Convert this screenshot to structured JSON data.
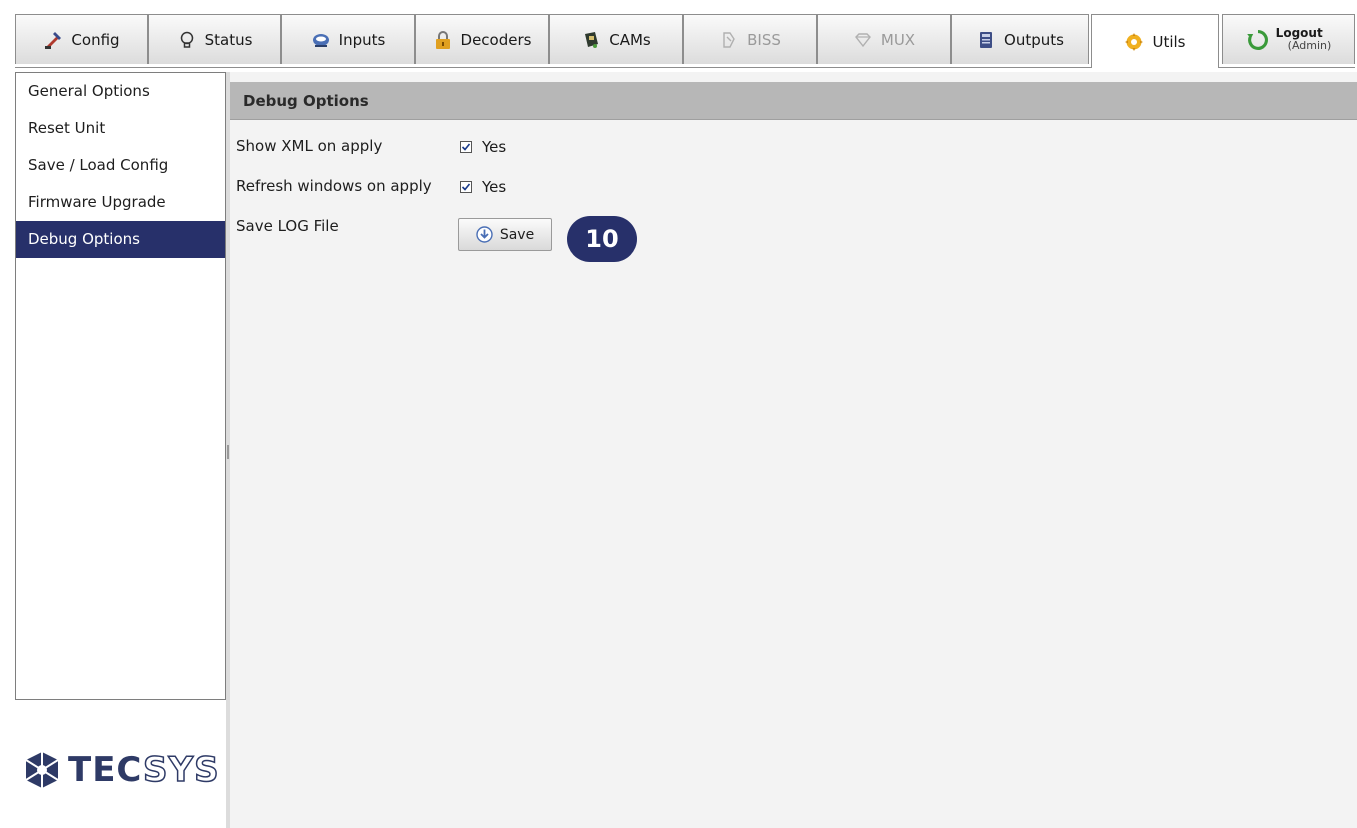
{
  "tabs": [
    {
      "label": "Config",
      "icon": "config-icon",
      "state": "normal"
    },
    {
      "label": "Status",
      "icon": "lightbulb-icon",
      "state": "normal"
    },
    {
      "label": "Inputs",
      "icon": "inputs-icon",
      "state": "normal"
    },
    {
      "label": "Decoders",
      "icon": "lock-icon",
      "state": "normal"
    },
    {
      "label": "CAMs",
      "icon": "cam-icon",
      "state": "normal"
    },
    {
      "label": "BISS",
      "icon": "biss-icon",
      "state": "disabled"
    },
    {
      "label": "MUX",
      "icon": "gem-icon",
      "state": "disabled"
    },
    {
      "label": "Outputs",
      "icon": "outputs-icon",
      "state": "normal"
    },
    {
      "label": "Utils",
      "icon": "utils-gear-icon",
      "state": "active"
    }
  ],
  "logout": {
    "label": "Logout",
    "user": "(Admin)",
    "icon": "logout-icon"
  },
  "sidebar": {
    "items": [
      {
        "label": "General Options"
      },
      {
        "label": "Reset Unit"
      },
      {
        "label": "Save / Load Config"
      },
      {
        "label": "Firmware Upgrade"
      },
      {
        "label": "Debug Options",
        "selected": true
      }
    ]
  },
  "logo": {
    "tec": "TEC",
    "sys": "SYS"
  },
  "main": {
    "section_title": "Debug Options",
    "show_xml": {
      "label": "Show XML on apply",
      "checked": true,
      "value_text": "Yes"
    },
    "refresh_windows": {
      "label": "Refresh windows on apply",
      "checked": true,
      "value_text": "Yes"
    },
    "save_log": {
      "label": "Save LOG File",
      "button_label": "Save"
    }
  },
  "callout": {
    "number": "10"
  },
  "colors": {
    "selected_bg": "#27306a",
    "header_bg": "#b7b7b7",
    "content_bg": "#f3f3f3",
    "logo_blue": "#2e3a66"
  }
}
